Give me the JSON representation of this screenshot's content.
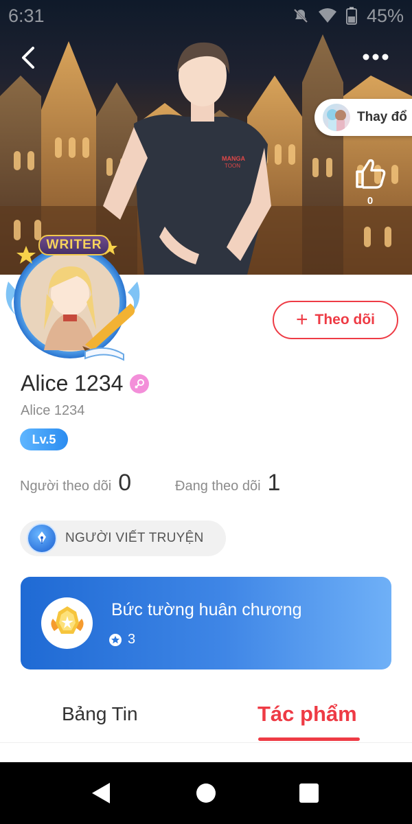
{
  "status_bar": {
    "time": "6:31",
    "battery": "45%",
    "icons": [
      "mute-icon",
      "wifi-icon",
      "battery-icon"
    ]
  },
  "header": {
    "back_icon": "chevron-left-icon",
    "more_icon": "more-horizontal-icon",
    "change_outfit_label": "Thay đổ",
    "like_icon": "thumbs-up-icon",
    "like_count": "0"
  },
  "profile": {
    "avatar_badge": "WRITER",
    "follow_label": "Theo dõi",
    "name": "Alice 1234",
    "handle": "Alice 1234",
    "level": "Lv.5",
    "gender_icon": "female-icon",
    "followers_label": "Người theo dõi",
    "followers_count": "0",
    "following_label": "Đang theo dõi",
    "following_count": "1",
    "role_label": "NGƯỜI VIẾT TRUYỆN",
    "role_icon": "pen-nib-icon"
  },
  "medal_wall": {
    "title": "Bức tường huân chương",
    "count": "3",
    "icon": "medal-icon"
  },
  "tabs": [
    {
      "label": "Bảng Tin",
      "active": false
    },
    {
      "label": "Tác phẩm",
      "active": true
    }
  ],
  "colors": {
    "accent": "#ee3b45",
    "level": "#2b8cf0",
    "medal_card": "#1f6ad4"
  }
}
